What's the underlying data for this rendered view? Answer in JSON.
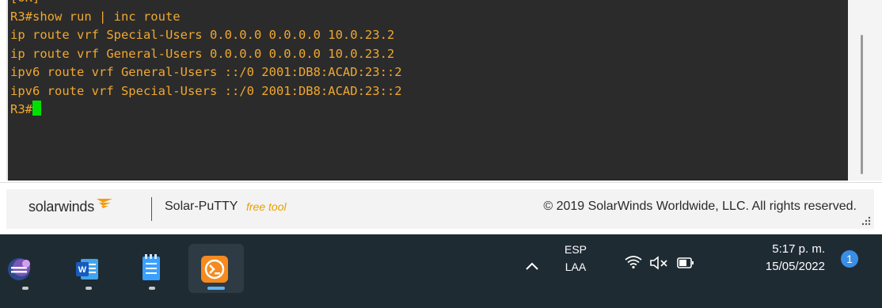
{
  "terminal": {
    "lines": [
      "[OK]",
      "R3#show run | inc route",
      "ip route vrf Special-Users 0.0.0.0 0.0.0.0 10.0.23.2",
      "ip route vrf General-Users 0.0.0.0 0.0.0.0 10.0.23.2",
      "ipv6 route vrf General-Users ::/0 2001:DB8:ACAD:23::2",
      "ipv6 route vrf Special-Users ::/0 2001:DB8:ACAD:23::2"
    ],
    "prompt": "R3#",
    "text_color": "#f0a830",
    "cursor_color": "#00e000"
  },
  "banner": {
    "brand": "solarwinds",
    "product": "Solar-PuTTY",
    "product_tag": "free tool",
    "copyright": "© 2019 SolarWinds Worldwide, LLC. All rights reserved."
  },
  "taskbar": {
    "apps": [
      {
        "icon": "eclipse-app-icon"
      },
      {
        "icon": "word-app-icon"
      },
      {
        "icon": "notepad-app-icon"
      },
      {
        "icon": "solar-putty-app-icon",
        "active": true
      }
    ],
    "language": "ESP",
    "layout": "LAA",
    "time": "5:17 p. m.",
    "date": "15/05/2022",
    "notifications": "1"
  }
}
